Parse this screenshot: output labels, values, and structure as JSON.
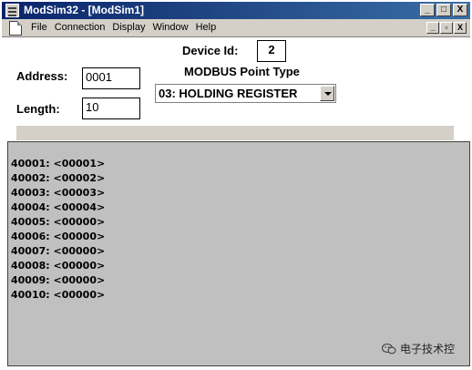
{
  "window": {
    "title": "ModSim32 - [ModSim1]",
    "controls": {
      "minimize": "_",
      "maximize": "□",
      "close": "X"
    },
    "mdi_controls": {
      "minimize": "_",
      "restore": "▫",
      "close": "X"
    }
  },
  "menu": [
    "File",
    "Connection",
    "Display",
    "Window",
    "Help"
  ],
  "form": {
    "device_id_label": "Device Id:",
    "device_id_value": "2",
    "point_type_label": "MODBUS Point Type",
    "point_type_value": "03: HOLDING REGISTER",
    "address_label": "Address:",
    "address_value": "0001",
    "length_label": "Length:",
    "length_value": "10"
  },
  "registers": [
    "40001: <00001>",
    "40002: <00002>",
    "40003: <00003>",
    "40004: <00004>",
    "40005: <00000>",
    "40006: <00000>",
    "40007: <00000>",
    "40008: <00000>",
    "40009: <00000>",
    "40010: <00000>"
  ],
  "watermark": {
    "text": "电子技术控"
  },
  "colors": {
    "title_bar_start": "#0a246a",
    "title_bar_end": "#3a6ea5",
    "chrome": "#d4d0c8",
    "register_panel": "#c0c0c0"
  },
  "icons": {
    "app": "modsim-app-icon",
    "document": "document-icon",
    "dropdown": "dropdown-arrow-icon",
    "watermark": "wechat-icon"
  }
}
